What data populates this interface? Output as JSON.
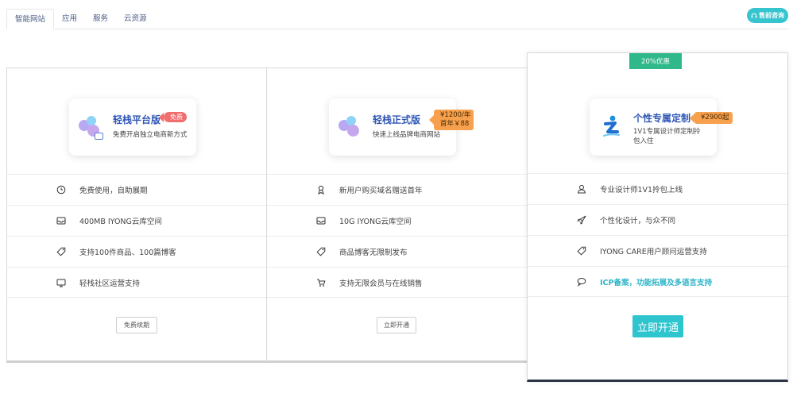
{
  "tabs": [
    "智能网站",
    "应用",
    "服务",
    "云资源"
  ],
  "consult_button": "售前咨询",
  "plans": [
    {
      "title": "轻栈平台版",
      "price_tag": "免费",
      "desc": "免费开启独立电商新方式",
      "features": [
        {
          "icon": "clock-icon",
          "text": "免费使用，自助展期"
        },
        {
          "icon": "inbox-icon",
          "text": "400MB IYONG云库空间"
        },
        {
          "icon": "tag-icon",
          "text": "支持100件商品、100篇博客"
        },
        {
          "icon": "monitor-icon",
          "text": "轻栈社区运营支持"
        }
      ],
      "button": "免费续期"
    },
    {
      "title": "轻栈正式版",
      "price_tag_line1": "¥1200/年",
      "price_tag_line2": "首年￥88",
      "desc": "快速上线品牌电商网站",
      "features": [
        {
          "icon": "gift-icon",
          "text": "新用户购买域名赠送首年"
        },
        {
          "icon": "inbox-icon",
          "text": "10G IYONG云库空间"
        },
        {
          "icon": "tag-icon",
          "text": "商品博客无限制发布"
        },
        {
          "icon": "cart-icon",
          "text": "支持无限会员与在线销售"
        }
      ],
      "button": "立即开通"
    },
    {
      "promo": "20%优惠",
      "title": "个性专属定制",
      "price_tag": "¥2900起",
      "desc": "1V1专属设计师定制拎包入住",
      "features": [
        {
          "icon": "user-icon",
          "text": "专业设计师1V1拎包上线"
        },
        {
          "icon": "rocket-icon",
          "text": "个性化设计，与众不同"
        },
        {
          "icon": "tag-icon",
          "text": "IYONG CARE用户顾问运营支持"
        },
        {
          "icon": "chat-icon",
          "text": "ICP备案，功能拓展及多语言支持"
        }
      ],
      "button": "立即开通"
    }
  ],
  "colors": {
    "accent": "#36c4cf",
    "promo": "#2fb88a",
    "free_badge": "#f26d6d",
    "price_badge": "#f7a14e",
    "title_blue": "#2f56b6"
  }
}
